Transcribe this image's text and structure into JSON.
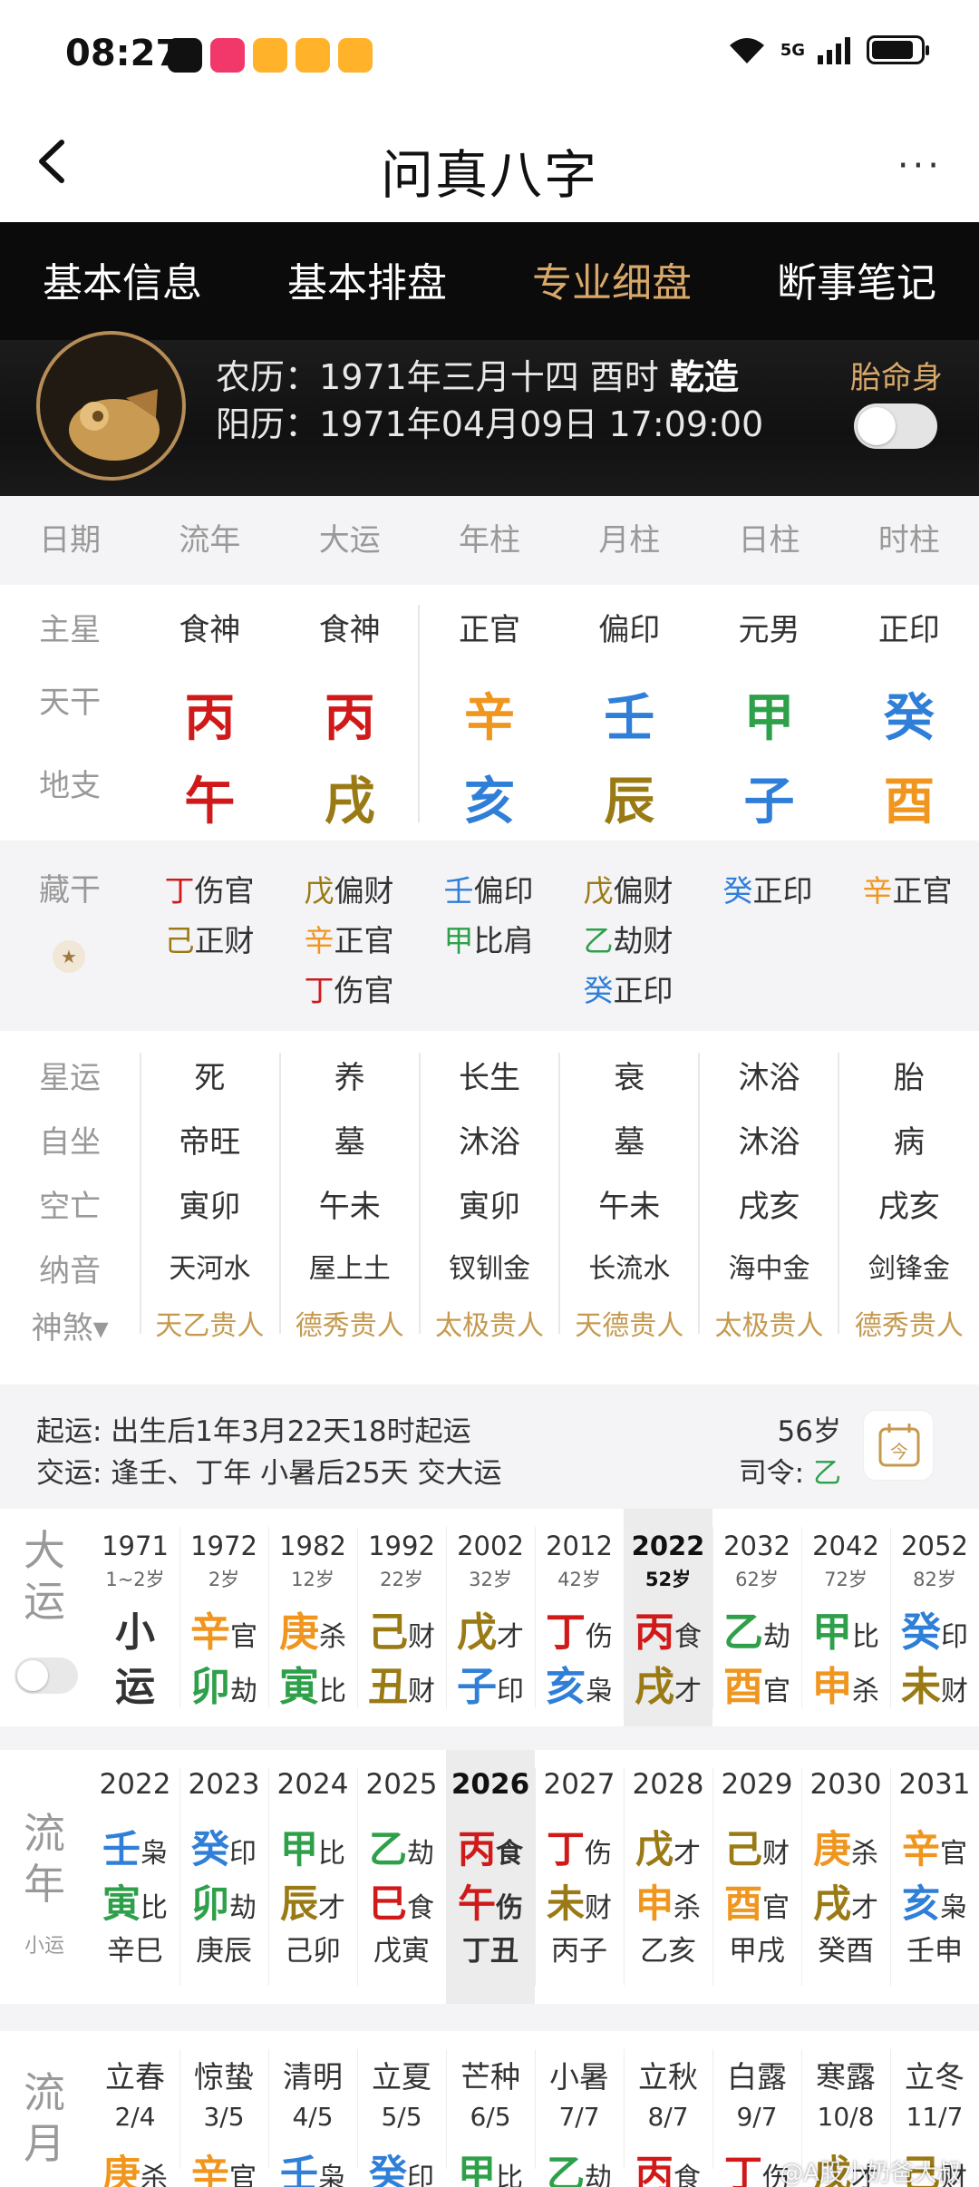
{
  "status": {
    "time": "08:27",
    "network": "5G"
  },
  "header": {
    "title": "问真八字",
    "more": "···"
  },
  "tabs": [
    "基本信息",
    "基本排盘",
    "专业细盘",
    "断事笔记"
  ],
  "banner": {
    "lunar_prefix": "农历：",
    "lunar": "1971年三月十四 酉时",
    "gender": "乾造",
    "solar_prefix": "阳历：",
    "solar": "1971年04月09日 17:09:00",
    "tai_ming_shen": "胎命身"
  },
  "columns": [
    "日期",
    "流年",
    "大运",
    "年柱",
    "月柱",
    "日柱",
    "时柱"
  ],
  "pillars": {
    "zhuxing_label": "主星",
    "zhuxing": [
      "食神",
      "食神",
      "正官",
      "偏印",
      "元男",
      "正印"
    ],
    "tiangan_label": "天干",
    "tiangan": [
      {
        "char": "丙",
        "color": "#d01a1a"
      },
      {
        "char": "丙",
        "color": "#d01a1a"
      },
      {
        "char": "辛",
        "color": "#f0961e"
      },
      {
        "char": "壬",
        "color": "#2f7fd8"
      },
      {
        "char": "甲",
        "color": "#2ea04a"
      },
      {
        "char": "癸",
        "color": "#2f7fd8"
      }
    ],
    "dizhi_label": "地支",
    "dizhi": [
      {
        "char": "午",
        "color": "#d01a1a"
      },
      {
        "char": "戌",
        "color": "#9a7a14"
      },
      {
        "char": "亥",
        "color": "#2f7fd8"
      },
      {
        "char": "辰",
        "color": "#9a7a14"
      },
      {
        "char": "子",
        "color": "#2f7fd8"
      },
      {
        "char": "酉",
        "color": "#f0961e"
      }
    ]
  },
  "canggan": {
    "label": "藏干",
    "columns": [
      [
        {
          "g": "丁",
          "s": "伤官",
          "c": "#d01a1a"
        },
        {
          "g": "己",
          "s": "正财",
          "c": "#9a7a14"
        }
      ],
      [
        {
          "g": "戊",
          "s": "偏财",
          "c": "#9a7a14"
        },
        {
          "g": "辛",
          "s": "正官",
          "c": "#f0961e"
        },
        {
          "g": "丁",
          "s": "伤官",
          "c": "#d01a1a"
        }
      ],
      [
        {
          "g": "壬",
          "s": "偏印",
          "c": "#2f7fd8"
        },
        {
          "g": "甲",
          "s": "比肩",
          "c": "#2ea04a"
        }
      ],
      [
        {
          "g": "戊",
          "s": "偏财",
          "c": "#9a7a14"
        },
        {
          "g": "乙",
          "s": "劫财",
          "c": "#2ea04a"
        },
        {
          "g": "癸",
          "s": "正印",
          "c": "#2f7fd8"
        }
      ],
      [
        {
          "g": "癸",
          "s": "正印",
          "c": "#2f7fd8"
        }
      ],
      [
        {
          "g": "辛",
          "s": "正官",
          "c": "#f0961e"
        }
      ]
    ]
  },
  "fortune": {
    "xingyun_label": "星运",
    "xingyun": [
      "死",
      "养",
      "长生",
      "衰",
      "沐浴",
      "胎"
    ],
    "zizuo_label": "自坐",
    "zizuo": [
      "帝旺",
      "墓",
      "沐浴",
      "墓",
      "沐浴",
      "病"
    ],
    "kongwang_label": "空亡",
    "kongwang": [
      "寅卯",
      "午未",
      "寅卯",
      "午未",
      "戌亥",
      "戌亥"
    ],
    "nayin_label": "纳音",
    "nayin": [
      "天河水",
      "屋上土",
      "钗钏金",
      "长流水",
      "海中金",
      "剑锋金"
    ],
    "shensha_label": "神煞▾",
    "shensha": [
      "天乙贵人",
      "德秀贵人",
      "太极贵人",
      "天德贵人",
      "太极贵人",
      "德秀贵人"
    ]
  },
  "qiyun": {
    "line1": "起运:  出生后1年3月22天18时起运",
    "line2": "交运:  逢壬、丁年 小暑后25天 交大运",
    "age": "56岁",
    "siling_prefix": "司令:",
    "siling": "乙"
  },
  "dayun": {
    "label": "大运",
    "items": [
      {
        "yr": "1971",
        "age": "1~2岁",
        "g": "小",
        "gs": "",
        "gc": "#333333",
        "z": "运",
        "zs": "",
        "zc": "#333333"
      },
      {
        "yr": "1972",
        "age": "2岁",
        "g": "辛",
        "gs": "官",
        "gc": "#f0961e",
        "z": "卯",
        "zs": "劫",
        "zc": "#2ea04a"
      },
      {
        "yr": "1982",
        "age": "12岁",
        "g": "庚",
        "gs": "杀",
        "gc": "#f0961e",
        "z": "寅",
        "zs": "比",
        "zc": "#2ea04a"
      },
      {
        "yr": "1992",
        "age": "22岁",
        "g": "己",
        "gs": "财",
        "gc": "#9a7a14",
        "z": "丑",
        "zs": "财",
        "zc": "#9a7a14"
      },
      {
        "yr": "2002",
        "age": "32岁",
        "g": "戊",
        "gs": "才",
        "gc": "#9a7a14",
        "z": "子",
        "zs": "印",
        "zc": "#2f7fd8"
      },
      {
        "yr": "2012",
        "age": "42岁",
        "g": "丁",
        "gs": "伤",
        "gc": "#d01a1a",
        "z": "亥",
        "zs": "枭",
        "zc": "#2f7fd8"
      },
      {
        "yr": "2022",
        "age": "52岁",
        "g": "丙",
        "gs": "食",
        "gc": "#d01a1a",
        "z": "戌",
        "zs": "才",
        "zc": "#9a7a14"
      },
      {
        "yr": "2032",
        "age": "62岁",
        "g": "乙",
        "gs": "劫",
        "gc": "#2ea04a",
        "z": "酉",
        "zs": "官",
        "zc": "#f0961e"
      },
      {
        "yr": "2042",
        "age": "72岁",
        "g": "甲",
        "gs": "比",
        "gc": "#2ea04a",
        "z": "申",
        "zs": "杀",
        "zc": "#f0961e"
      },
      {
        "yr": "2052",
        "age": "82岁",
        "g": "癸",
        "gs": "印",
        "gc": "#2f7fd8",
        "z": "未",
        "zs": "财",
        "zc": "#9a7a14"
      }
    ]
  },
  "liunian": {
    "label": "流年",
    "sub": "小运",
    "items": [
      {
        "yr": "2022",
        "g": "壬",
        "gs": "枭",
        "gc": "#2f7fd8",
        "z": "寅",
        "zs": "比",
        "zc": "#2ea04a",
        "gz": "辛巳"
      },
      {
        "yr": "2023",
        "g": "癸",
        "gs": "印",
        "gc": "#2f7fd8",
        "z": "卯",
        "zs": "劫",
        "zc": "#2ea04a",
        "gz": "庚辰"
      },
      {
        "yr": "2024",
        "g": "甲",
        "gs": "比",
        "gc": "#2ea04a",
        "z": "辰",
        "zs": "才",
        "zc": "#9a7a14",
        "gz": "己卯"
      },
      {
        "yr": "2025",
        "g": "乙",
        "gs": "劫",
        "gc": "#2ea04a",
        "z": "巳",
        "zs": "食",
        "zc": "#d01a1a",
        "gz": "戊寅"
      },
      {
        "yr": "2026",
        "g": "丙",
        "gs": "食",
        "gc": "#d01a1a",
        "z": "午",
        "zs": "伤",
        "zc": "#d01a1a",
        "gz": "丁丑"
      },
      {
        "yr": "2027",
        "g": "丁",
        "gs": "伤",
        "gc": "#d01a1a",
        "z": "未",
        "zs": "财",
        "zc": "#9a7a14",
        "gz": "丙子"
      },
      {
        "yr": "2028",
        "g": "戊",
        "gs": "才",
        "gc": "#9a7a14",
        "z": "申",
        "zs": "杀",
        "zc": "#f0961e",
        "gz": "乙亥"
      },
      {
        "yr": "2029",
        "g": "己",
        "gs": "财",
        "gc": "#9a7a14",
        "z": "酉",
        "zs": "官",
        "zc": "#f0961e",
        "gz": "甲戌"
      },
      {
        "yr": "2030",
        "g": "庚",
        "gs": "杀",
        "gc": "#f0961e",
        "z": "戌",
        "zs": "才",
        "zc": "#9a7a14",
        "gz": "癸酉"
      },
      {
        "yr": "2031",
        "g": "辛",
        "gs": "官",
        "gc": "#f0961e",
        "z": "亥",
        "zs": "枭",
        "zc": "#2f7fd8",
        "gz": "壬申"
      }
    ]
  },
  "liuyue": {
    "label": "流月",
    "items": [
      {
        "jq": "立春",
        "dt": "2/4",
        "g": "庚",
        "gs": "杀",
        "gc": "#f0961e"
      },
      {
        "jq": "惊蛰",
        "dt": "3/5",
        "g": "辛",
        "gs": "官",
        "gc": "#f0961e"
      },
      {
        "jq": "清明",
        "dt": "4/5",
        "g": "壬",
        "gs": "枭",
        "gc": "#2f7fd8"
      },
      {
        "jq": "立夏",
        "dt": "5/5",
        "g": "癸",
        "gs": "印",
        "gc": "#2f7fd8"
      },
      {
        "jq": "芒种",
        "dt": "6/5",
        "g": "甲",
        "gs": "比",
        "gc": "#2ea04a"
      },
      {
        "jq": "小暑",
        "dt": "7/7",
        "g": "乙",
        "gs": "劫",
        "gc": "#2ea04a"
      },
      {
        "jq": "立秋",
        "dt": "8/7",
        "g": "丙",
        "gs": "食",
        "gc": "#d01a1a"
      },
      {
        "jq": "白露",
        "dt": "9/7",
        "g": "丁",
        "gs": "伤",
        "gc": "#d01a1a"
      },
      {
        "jq": "寒露",
        "dt": "10/8",
        "g": "戊",
        "gs": "才",
        "gc": "#9a7a14"
      },
      {
        "jq": "立冬",
        "dt": "11/7",
        "g": "己",
        "gs": "财",
        "gc": "#9a7a14"
      }
    ]
  },
  "highlight": {
    "dayun_year": "2022",
    "liunian_year": "2026"
  },
  "watermark": "@A股小奶爸大叔"
}
